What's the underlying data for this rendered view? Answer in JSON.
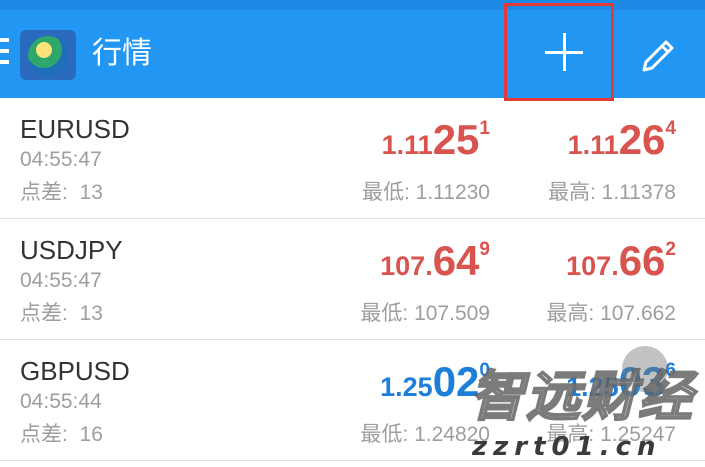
{
  "header": {
    "title": "行情",
    "add_label": "+",
    "bg_color": "#2196f3",
    "icons": [
      "menu-icon",
      "app-logo-icon",
      "plus-icon",
      "pencil-icon"
    ]
  },
  "quotes": [
    {
      "symbol": "EURUSD",
      "time": "04:55:47",
      "spread_label": "点差:",
      "spread": "13",
      "color": "red",
      "bid": {
        "small": "1.11",
        "big": "25",
        "sup": "1"
      },
      "ask": {
        "small": "1.11",
        "big": "26",
        "sup": "4"
      },
      "low": "最低: 1.11230",
      "high": "最高: 1.11378"
    },
    {
      "symbol": "USDJPY",
      "time": "04:55:47",
      "spread_label": "点差:",
      "spread": "13",
      "color": "red",
      "bid": {
        "small": "107.",
        "big": "64",
        "sup": "9"
      },
      "ask": {
        "small": "107.",
        "big": "66",
        "sup": "2"
      },
      "low": "最低: 107.509",
      "high": "最高: 107.662"
    },
    {
      "symbol": "GBPUSD",
      "time": "04:55:44",
      "spread_label": "点差:",
      "spread": "16",
      "color": "blue",
      "bid": {
        "small": "1.25",
        "big": "02",
        "sup": "0"
      },
      "ask": {
        "small": "1.25",
        "big": "03",
        "sup": "6"
      },
      "low": "最低: 1.24820",
      "high": "最高: 1.25247"
    }
  ],
  "watermark": {
    "chinese": "智远财经",
    "url": "zzrt01.cn"
  },
  "colors": {
    "up": "#1e7fd8",
    "down": "#d9534f"
  }
}
